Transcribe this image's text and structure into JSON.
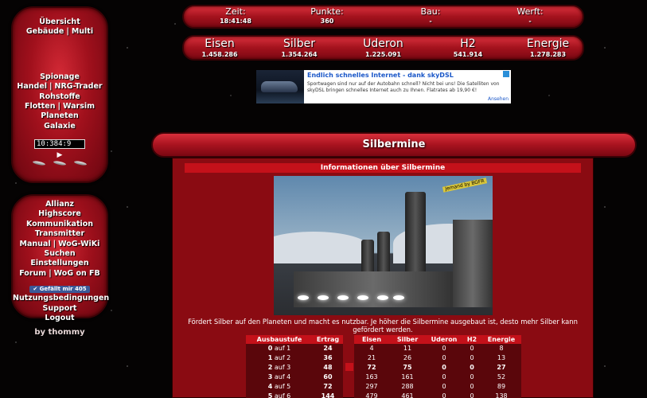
{
  "colors": {
    "accent": "#c4111a",
    "panel": "#a0101c",
    "background": "#050303"
  },
  "nav_top": {
    "row1": "Übersicht",
    "row2": [
      "Gebäude",
      "Multi"
    ],
    "row3": "Spionage",
    "row4": [
      "Handel",
      "NRG-Trader"
    ],
    "row5": "Rohstoffe",
    "row6": [
      "Flotten",
      "Warsim"
    ],
    "row7": "Planeten",
    "row8": "Galaxie",
    "clock_value": "10:384:9",
    "icons": [
      "play-icon",
      "ship-icon",
      "ship-icon",
      "ship-icon"
    ]
  },
  "nav_bottom": {
    "items": [
      [
        "Allianz"
      ],
      [
        "Highscore"
      ],
      [
        "Kommunikation"
      ],
      [
        "Transmitter"
      ],
      [
        "Manual",
        "WoG-WiKi"
      ],
      [
        "Suchen"
      ],
      [
        "Einstellungen"
      ],
      [
        "Forum",
        "WoG on FB"
      ]
    ],
    "like_label": "Gefällt mir 405",
    "items2": [
      "Nutzungsbedingungen",
      "Support",
      "Logout"
    ],
    "byline": "by thommy"
  },
  "status": {
    "zeit_label": "Zeit:",
    "zeit_value": "18:41:48",
    "punkte_label": "Punkte:",
    "punkte_value": "360",
    "bau_label": "Bau:",
    "bau_value": "-",
    "werft_label": "Werft:",
    "werft_value": "-"
  },
  "resources": {
    "eisen_label": "Eisen",
    "eisen_value": "1.458.286",
    "silber_label": "Silber",
    "silber_value": "1.354.264",
    "uderon_label": "Uderon",
    "uderon_value": "1.225.091",
    "h2_label": "H2",
    "h2_value": "541.914",
    "energie_label": "Energie",
    "energie_value": "1.278.283"
  },
  "ad": {
    "title": "Endlich schnelles Internet - dank skyDSL",
    "body": "Sportwagen sind nur auf der Autobahn schnell? Nicht bei uns! Die Satelliten von skyDSL bringen schnelles Internet auch zu Ihnen. Flatrates ab 19,90 €!",
    "more": "Ansehen"
  },
  "main": {
    "title": "Silbermine",
    "info_heading": "Informationen über Silbermine",
    "image_tag": "Jemand by BGFR",
    "description": "Fördert Silber auf den Planeten und macht es nutzbar. Je höher die Silbermine ausgebaut ist, desto mehr Silber kann gefördert werden."
  },
  "table1": {
    "headers": [
      "Ausbaustufe",
      "Ertrag"
    ],
    "rows": [
      {
        "from": "0",
        "to": "auf 1",
        "ertrag": "24"
      },
      {
        "from": "1",
        "to": "auf 2",
        "ertrag": "36"
      },
      {
        "from": "2",
        "to": "auf 3",
        "ertrag": "48"
      },
      {
        "from": "3",
        "to": "auf 4",
        "ertrag": "60"
      },
      {
        "from": "4",
        "to": "auf 5",
        "ertrag": "72"
      },
      {
        "from": "5",
        "to": "auf 6",
        "ertrag": "144"
      }
    ]
  },
  "table2": {
    "headers": [
      "Eisen",
      "Silber",
      "Uderon",
      "H2",
      "Energie"
    ],
    "rows": [
      [
        "4",
        "11",
        "0",
        "0",
        "8"
      ],
      [
        "21",
        "26",
        "0",
        "0",
        "13"
      ],
      [
        "72",
        "75",
        "0",
        "0",
        "27"
      ],
      [
        "163",
        "161",
        "0",
        "0",
        "52"
      ],
      [
        "297",
        "288",
        "0",
        "0",
        "89"
      ],
      [
        "479",
        "461",
        "0",
        "0",
        "138"
      ]
    ]
  }
}
